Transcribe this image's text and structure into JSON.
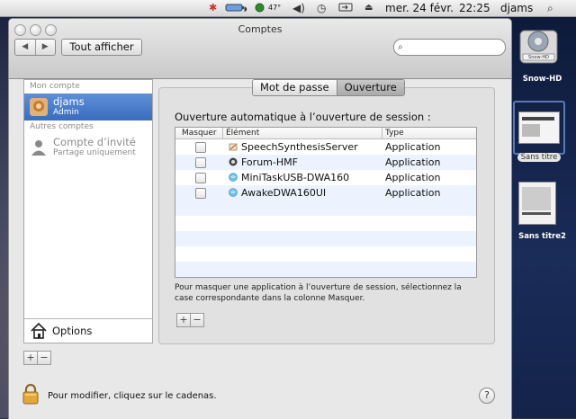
{
  "menubar": {
    "date": "mer. 24 févr.",
    "time": "22:25",
    "user": "djams",
    "temperature": "47°",
    "icons": [
      "lobster-icon",
      "battery-icon",
      "temperature-icon",
      "volume-icon",
      "time-machine-icon",
      "input-menu-icon",
      "eject-icon",
      "spotlight-icon"
    ]
  },
  "window": {
    "title": "Comptes",
    "show_all": "Tout afficher",
    "search_placeholder": ""
  },
  "sidebar": {
    "my_account_header": "Mon compte",
    "user_name": "djams",
    "user_role": "Admin",
    "other_accounts_header": "Autres comptes",
    "guest_name": "Compte d’invité",
    "guest_sub": "Partage uniquement",
    "options_label": "Options",
    "add_label": "+",
    "remove_label": "−"
  },
  "tabs": {
    "password": "Mot de passe",
    "login_items": "Ouverture",
    "active": "login_items"
  },
  "login_items": {
    "heading": "Ouverture automatique à l’ouverture de session :",
    "columns": {
      "hide": "Masquer",
      "item": "Élément",
      "type": "Type"
    },
    "rows": [
      {
        "name": "SpeechSynthesisServer",
        "type": "Application",
        "hidden": false,
        "icon": "speech-app-icon"
      },
      {
        "name": "Forum-HMF",
        "type": "Application",
        "hidden": false,
        "icon": "forum-app-icon"
      },
      {
        "name": "MiniTaskUSB-DWA160",
        "type": "Application",
        "hidden": false,
        "icon": "wifi-app-icon"
      },
      {
        "name": "AwakeDWA160UI",
        "type": "Application",
        "hidden": false,
        "icon": "wifi-app-icon"
      }
    ],
    "note": "Pour masquer une application à l’ouverture de session, sélectionnez la case correspondante dans la colonne Masquer.",
    "add_label": "+",
    "remove_label": "−"
  },
  "footer": {
    "lock_text": "Pour modifier, cliquez sur le cadenas.",
    "help_label": "?"
  },
  "desktop": {
    "disk_label": "Snow-HD",
    "file1": "Sans titre",
    "file2": "Sans titre2",
    "disk_badge": "Snow-HD"
  },
  "colors": {
    "selection": "#3a6cc0",
    "window_bg": "#e8e8e8",
    "alt_row": "#edf3fe"
  }
}
